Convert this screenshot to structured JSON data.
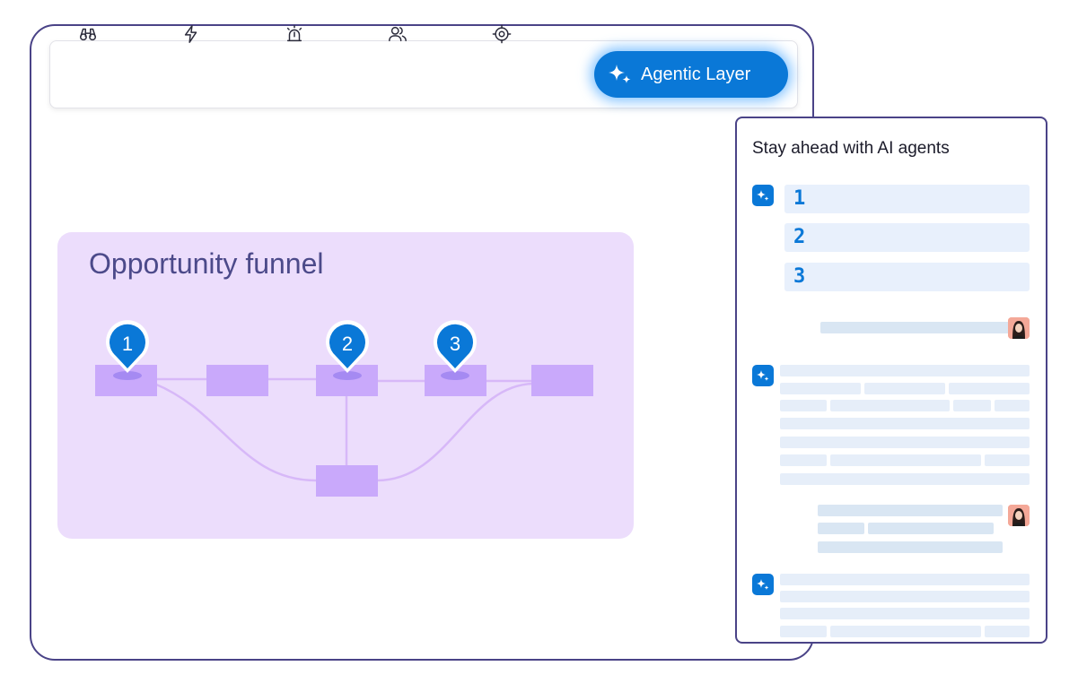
{
  "toolbar": {
    "icons": [
      {
        "name": "binoculars-icon"
      },
      {
        "name": "lightning-icon"
      },
      {
        "name": "alarm-siren-icon"
      },
      {
        "name": "users-icon"
      },
      {
        "name": "target-icon"
      }
    ],
    "agentic_button": {
      "label": "Agentic Layer",
      "icon": "sparkle-icon"
    }
  },
  "funnel": {
    "title": "Opportunity funnel",
    "pins": [
      "1",
      "2",
      "3"
    ]
  },
  "chat": {
    "title": "Stay ahead with AI agents",
    "options": [
      "1",
      "2",
      "3"
    ]
  },
  "colors": {
    "accent": "#0a78d7",
    "frame": "#4a4387",
    "funnel_bg": "#ecddfc",
    "node": "#c9a9fb",
    "connector": "#d7b8f8",
    "funnel_title": "#4c4a8a",
    "option_bg": "#e8f0fc"
  }
}
